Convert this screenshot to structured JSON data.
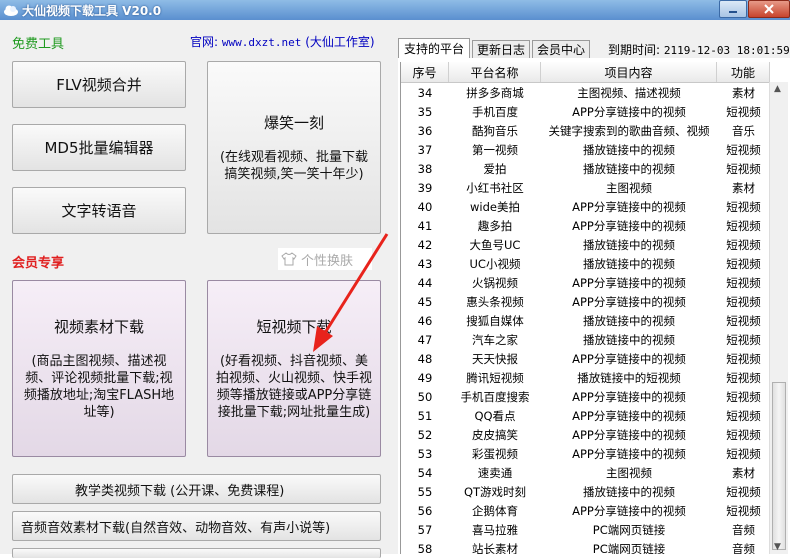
{
  "window": {
    "title": "大仙视频下载工具 V20.0"
  },
  "left": {
    "free_section": "免费工具",
    "official_prefix": "官网:",
    "official_url": "www.dxzt.net",
    "official_suffix": "(大仙工作室)",
    "btn_flv": "FLV视频合并",
    "btn_md5": "MD5批量编辑器",
    "btn_tts": "文字转语音",
    "btn_funny_title": "爆笑一刻",
    "btn_funny_desc": "(在线观看视频、批量下载搞笑视频,笑一笑十年少)",
    "skin_label": "个性换肤",
    "vip_section": "会员专享",
    "btn_material_title": "视频素材下载",
    "btn_material_desc": "(商品主图视频、描述视频、评论视频批量下载;视频播放地址;淘宝FLASH地址等)",
    "btn_short_title": "短视频下载",
    "btn_short_desc": "(好看视频、抖音视频、美拍视频、火山视频、快手视频等播放链接或APP分享链接批量下载;网址批量生成)",
    "btn_teach": "教学类视频下载 (公开课、免费课程)",
    "btn_audio": "音频音效素材下载(自然音效、动物音效、有声小说等)"
  },
  "right": {
    "tabs": [
      "支持的平台",
      "更新日志",
      "会员中心"
    ],
    "expire_label": "到期时间:",
    "expire_value": "2119-12-03 18:01:59",
    "columns": [
      "序号",
      "平台名称",
      "项目内容",
      "功能"
    ],
    "rows": [
      [
        "34",
        "拼多多商城",
        "主图视频、描述视频",
        "素材"
      ],
      [
        "35",
        "手机百度",
        "APP分享链接中的视频",
        "短视频"
      ],
      [
        "36",
        "酷狗音乐",
        "关键字搜索到的歌曲音频、视频",
        "音乐"
      ],
      [
        "37",
        "第一视频",
        "播放链接中的视频",
        "短视频"
      ],
      [
        "38",
        "爱拍",
        "播放链接中的视频",
        "短视频"
      ],
      [
        "39",
        "小红书社区",
        "主图视频",
        "素材"
      ],
      [
        "40",
        "wide美拍",
        "APP分享链接中的视频",
        "短视频"
      ],
      [
        "41",
        "趣多拍",
        "APP分享链接中的视频",
        "短视频"
      ],
      [
        "42",
        "大鱼号UC",
        "播放链接中的视频",
        "短视频"
      ],
      [
        "43",
        "UC小视频",
        "播放链接中的视频",
        "短视频"
      ],
      [
        "44",
        "火锅视频",
        "APP分享链接中的视频",
        "短视频"
      ],
      [
        "45",
        "惠头条视频",
        "APP分享链接中的视频",
        "短视频"
      ],
      [
        "46",
        "搜狐自媒体",
        "播放链接中的视频",
        "短视频"
      ],
      [
        "47",
        "汽车之家",
        "播放链接中的视频",
        "短视频"
      ],
      [
        "48",
        "天天快报",
        "APP分享链接中的视频",
        "短视频"
      ],
      [
        "49",
        "腾讯短视频",
        "播放链接中的短视频",
        "短视频"
      ],
      [
        "50",
        "手机百度搜索",
        "APP分享链接中的视频",
        "短视频"
      ],
      [
        "51",
        "QQ看点",
        "APP分享链接中的视频",
        "短视频"
      ],
      [
        "52",
        "皮皮搞笑",
        "APP分享链接中的视频",
        "短视频"
      ],
      [
        "53",
        "彩蛋视频",
        "APP分享链接中的视频",
        "短视频"
      ],
      [
        "54",
        "速卖通",
        "主图视频",
        "素材"
      ],
      [
        "55",
        "QT游戏时刻",
        "播放链接中的视频",
        "短视频"
      ],
      [
        "56",
        "企鹅体育",
        "APP分享链接中的视频",
        "短视频"
      ],
      [
        "57",
        "喜马拉雅",
        "PC端网页链接",
        "音频"
      ],
      [
        "58",
        "站长素材",
        "PC端网页链接",
        "音频"
      ]
    ]
  },
  "colors": {
    "free": "#1f9a1f",
    "vip": "#e02020",
    "link": "#0000c0",
    "arrow": "#e8231c"
  }
}
